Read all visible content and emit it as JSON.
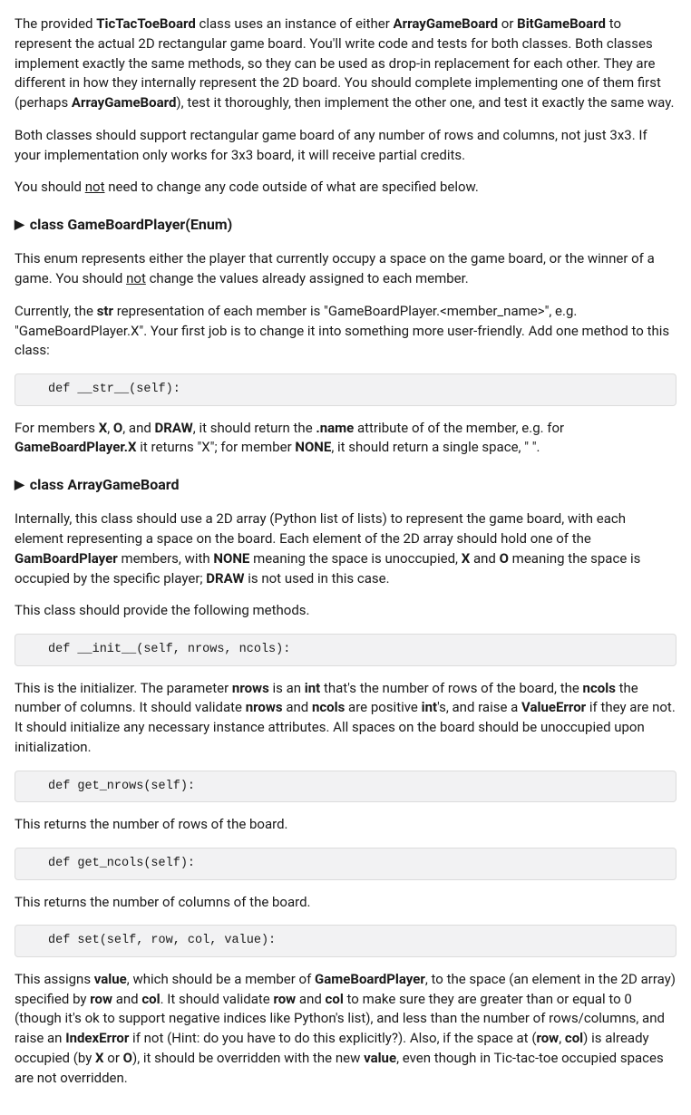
{
  "para1": {
    "a": "The provided ",
    "b": "TicTacToeBoard",
    "c": " class uses an instance of either ",
    "d": "ArrayGameBoard",
    "e": " or ",
    "f": "BitGameBoard",
    "g": " to represent the actual 2D rectangular game board.  You'll write code and tests for both classes.  Both classes implement exactly the same methods, so they can be used as drop-in replacement for each other.  They are different in how they internally represent the 2D board.  You should complete implementing one of them first (perhaps ",
    "h": "ArrayGameBoard",
    "i": "), test it thoroughly, then implement the other one, and test it exactly the same way."
  },
  "para2": "Both classes should support rectangular game board of any number of rows and columns, not just 3x3.  If your implementation only works for 3x3 board, it will receive partial credits.",
  "para3": {
    "a": "You should ",
    "b": "not",
    "c": " need to change any code outside of what are specified below."
  },
  "sec1": {
    "title": "class GameBoardPlayer(Enum)",
    "p1": {
      "a": "This enum represents either the player that currently occupy a space on the game board, or the winner of a game.  You should ",
      "b": "not",
      "c": " change the values already assigned to each member."
    },
    "p2": {
      "a": "Currently, the ",
      "b": "str",
      "c": " representation of each member is \"GameBoardPlayer.<member_name>\", e.g. \"GameBoardPlayer.X\".  Your first job is to change it into something more user-friendly.  Add one method to this class:"
    },
    "code1": "def __str__(self):",
    "p3": {
      "a": "For members ",
      "b": "X",
      "c": ", ",
      "d": "O",
      "e": ", and ",
      "f": "DRAW",
      "g": ", it should return the ",
      "h": ".name",
      "i": " attribute of of the member, e.g. for ",
      "j": "GameBoardPlayer.X",
      "k": " it returns \"X\"; for member ",
      "l": "NONE",
      "m": ", it should return a single space, \" \"."
    }
  },
  "sec2": {
    "title": "class ArrayGameBoard",
    "p1": {
      "a": "Internally, this class should use a 2D array (Python list of lists) to represent the game board, with each element representing a space on the board.  Each element of the 2D array should hold one of the ",
      "b": "GamBoardPlayer",
      "c": " members, with ",
      "d": "NONE",
      "e": " meaning the space is unoccupied, ",
      "f": "X",
      "g": " and ",
      "h": "O",
      "i": " meaning the space is occupied by the specific player; ",
      "j": "DRAW",
      "k": " is not used in this case."
    },
    "p2": "This class should provide the following methods.",
    "code_init": "def __init__(self, nrows, ncols):",
    "p3": {
      "a": "This is the initializer.  The parameter ",
      "b": "nrows",
      "c": " is an ",
      "d": "int",
      "e": " that's the number of rows of the board, the ",
      "f": "ncols",
      "g": " the number of columns.  It should validate ",
      "h": "nrows",
      "i": " and ",
      "j": "ncols",
      "k": " are positive ",
      "l": "int",
      "m": "'s, and raise a ",
      "n": "ValueError",
      "o": " if they are not.  It should initialize any necessary instance attributes.  All spaces on the board should be unoccupied upon initialization."
    },
    "code_getnrows": "def get_nrows(self):",
    "p4": "This returns the number of rows of the board.",
    "code_getncols": "def get_ncols(self):",
    "p5": "This returns the number of columns of the board.",
    "code_set": "def set(self, row, col, value):",
    "p6": {
      "a": "This assigns ",
      "b": "value",
      "c": ", which should be a member of ",
      "d": "GameBoardPlayer",
      "e": ", to the space (an element in the 2D array) specified by ",
      "f": "row",
      "g": " and ",
      "h": "col",
      "i": ".  It should validate ",
      "j": "row",
      "k": " and ",
      "l": "col",
      "m": " to make sure they are greater than or equal to 0 (though it's ok to support negative indices like Python's list), and less than the number of rows/columns, and raise an ",
      "n": "IndexError",
      "o": " if not (Hint: do you have to do this explicitly?).  Also, if the space at (",
      "p": "row",
      "q": ", ",
      "r": "col",
      "s": ") is already occupied (by ",
      "t": "X",
      "u": " or ",
      "v": "O",
      "w": "), it should be overridden with the new ",
      "x": "value",
      "y": ", even though in Tic-tac-toe occupied spaces are not overridden."
    }
  }
}
